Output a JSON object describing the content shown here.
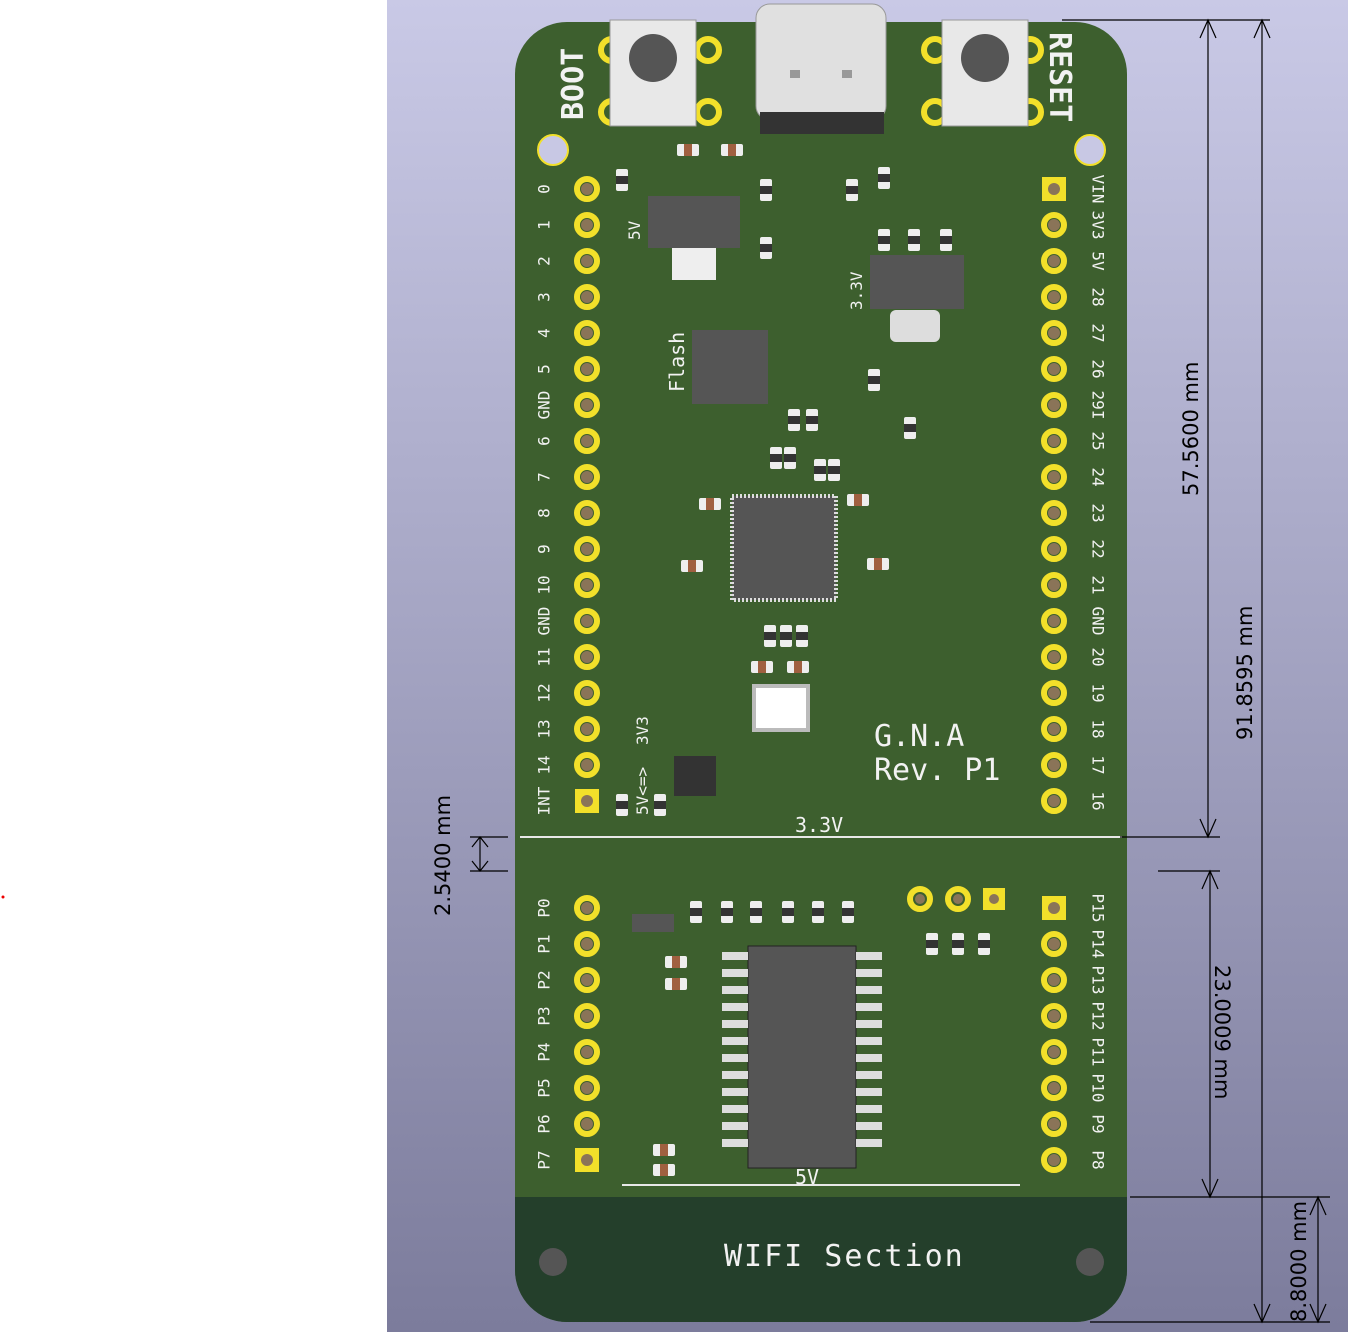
{
  "colors": {
    "board": "#3d5f2e",
    "board_dark": "#243f2b",
    "pad": "#f2e02a",
    "silk": "#f2f2f2",
    "background_top": "#c9c9e6",
    "background_bottom": "#7c7c9c"
  },
  "board": {
    "buttons": {
      "boot": "BOOT",
      "reset": "RESET"
    },
    "left_header": [
      "0",
      "1",
      "2",
      "3",
      "4",
      "5",
      "GND",
      "6",
      "7",
      "8",
      "9",
      "10",
      "GND",
      "11",
      "12",
      "13",
      "14",
      "INT"
    ],
    "right_header": [
      "VIN",
      "3V3",
      "5V",
      "28",
      "27",
      "26",
      "29I",
      "25",
      "24",
      "23",
      "22",
      "21",
      "GND",
      "20",
      "19",
      "18",
      "17",
      "16"
    ],
    "left_io": [
      "P0",
      "P1",
      "P2",
      "P3",
      "P4",
      "P5",
      "P6",
      "P7"
    ],
    "right_io": [
      "P15",
      "P14",
      "P13",
      "P12",
      "P11",
      "P10",
      "P9",
      "P8"
    ],
    "labels": {
      "reg5v": "5V",
      "reg33": "3.3V",
      "flash": "Flash",
      "level_a": "3V3",
      "level_b": "5V<=>",
      "name": "G.N.A",
      "rev": "Rev. P1",
      "rail33": "3.3V",
      "rail5": "5V",
      "wifi": "WIFI Section"
    }
  },
  "dimensions": {
    "d1": "57.5600 mm",
    "d2": "91.8595 mm",
    "d3": "23.0009 mm",
    "d4": "8.8000 mm",
    "d5": "2.5400 mm"
  }
}
